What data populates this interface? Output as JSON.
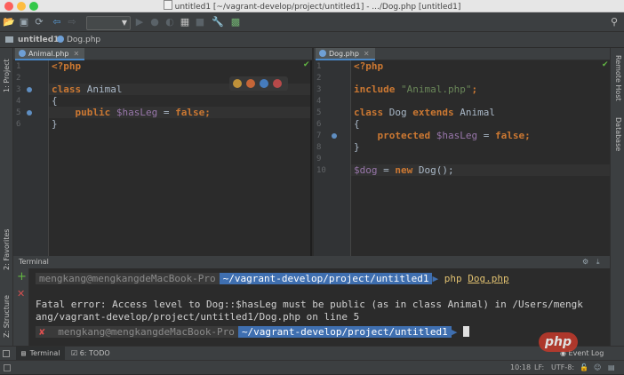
{
  "window": {
    "title": "untitled1 [~/vagrant-develop/project/untitled1] - .../Dog.php [untitled1]"
  },
  "navbar": {
    "project": "untitled1",
    "file": "Dog.php"
  },
  "left_tools": {
    "project": "1: Project",
    "favorites": "2: Favorites",
    "structure": "Z: Structure"
  },
  "right_tools": {
    "remote_host": "Remote Host",
    "database": "Database"
  },
  "left_editor": {
    "tab": "Animal.php",
    "line_numbers": [
      "1",
      "2",
      "3",
      "4",
      "5",
      "6"
    ],
    "lines": [
      [
        {
          "t": "<?php",
          "c": "kw"
        }
      ],
      [],
      [
        {
          "t": "class ",
          "c": "kw"
        },
        {
          "t": "Animal",
          "c": "plain"
        }
      ],
      [
        {
          "t": "{",
          "c": "plain"
        }
      ],
      [
        {
          "t": "    public ",
          "c": "kw"
        },
        {
          "t": "$hasLeg",
          "c": "var"
        },
        {
          "t": " = ",
          "c": "plain"
        },
        {
          "t": "false",
          "c": "kw"
        },
        {
          "t": ";",
          "c": "kw"
        }
      ],
      [
        {
          "t": "}",
          "c": "plain"
        }
      ]
    ]
  },
  "right_editor": {
    "tab": "Dog.php",
    "line_numbers": [
      "1",
      "2",
      "3",
      "4",
      "5",
      "6",
      "7",
      "8",
      "9",
      "10"
    ],
    "lines": [
      [
        {
          "t": "<?php",
          "c": "kw"
        }
      ],
      [],
      [
        {
          "t": "include ",
          "c": "kw"
        },
        {
          "t": "\"Animal.php\"",
          "c": "str"
        },
        {
          "t": ";",
          "c": "kw"
        }
      ],
      [],
      [
        {
          "t": "class ",
          "c": "kw"
        },
        {
          "t": "Dog ",
          "c": "plain"
        },
        {
          "t": "extends ",
          "c": "kw"
        },
        {
          "t": "Animal",
          "c": "plain"
        }
      ],
      [
        {
          "t": "{",
          "c": "plain"
        }
      ],
      [
        {
          "t": "    protected ",
          "c": "kw"
        },
        {
          "t": "$hasLeg",
          "c": "var"
        },
        {
          "t": " = ",
          "c": "plain"
        },
        {
          "t": "false",
          "c": "kw"
        },
        {
          "t": ";",
          "c": "kw"
        }
      ],
      [
        {
          "t": "}",
          "c": "plain"
        }
      ],
      [],
      [
        {
          "t": "$dog",
          "c": "var"
        },
        {
          "t": " = ",
          "c": "plain"
        },
        {
          "t": "new ",
          "c": "kw"
        },
        {
          "t": "Dog",
          "c": "plain"
        },
        {
          "t": "();",
          "c": "plain"
        }
      ]
    ]
  },
  "terminal": {
    "title": "Terminal",
    "prompt_user": "mengkang@mengkangdeMacBook-Pro",
    "prompt_path": "~/vagrant-develop/project/untitled1",
    "command": "php",
    "command_arg": "Dog.php",
    "error_line1": "Fatal error: Access level to Dog::$hasLeg must be public (as in class Animal) in /Users/mengk",
    "error_line2": "ang/vagrant-develop/project/untitled1/Dog.php on line 5",
    "error_mark": "✘"
  },
  "bottom_tabs": {
    "terminal": "Terminal",
    "todo": "6: TODO",
    "event_log": "Event Log"
  },
  "status": {
    "position": "10:18",
    "line_sep": "LF:",
    "encoding": "UTF-8:"
  },
  "watermark": "php",
  "colors": {
    "keyword": "#cc7832",
    "variable": "#9876aa",
    "string": "#6a8759",
    "prompt_path_bg": "#3f6fb0"
  }
}
